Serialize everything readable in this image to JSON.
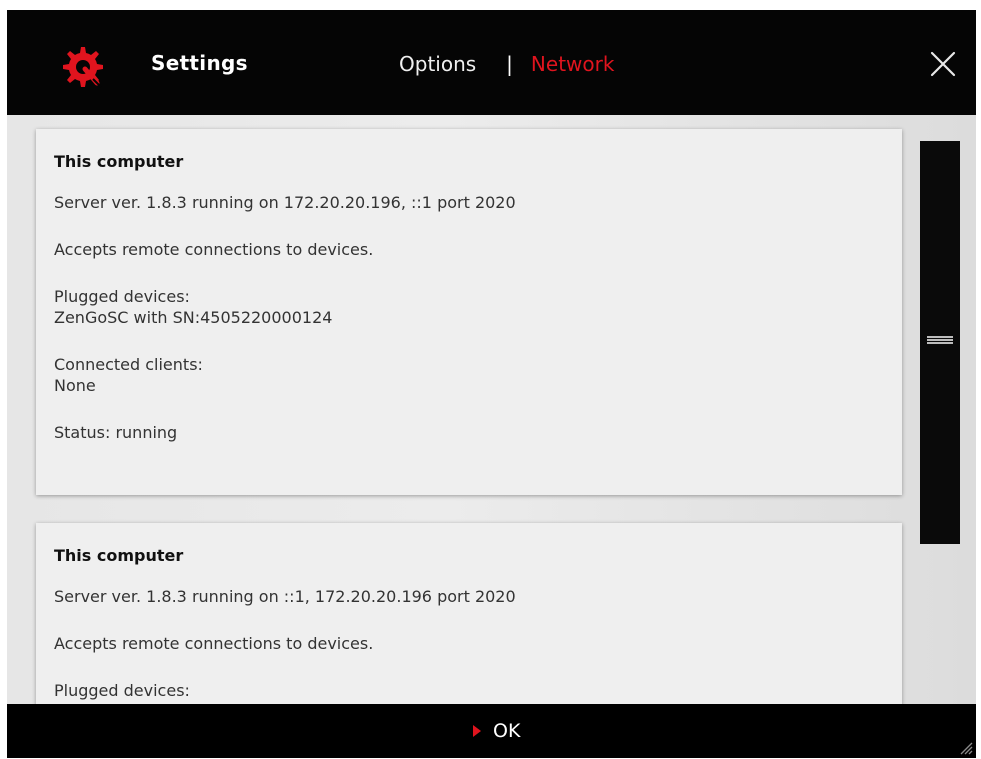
{
  "window": {
    "title": "Settings",
    "close_icon": "close-icon",
    "logo_icon": "gear-icon",
    "accent_color": "#e0141e"
  },
  "tabs": [
    {
      "label": "Options",
      "active": false
    },
    {
      "label": "Network",
      "active": true
    }
  ],
  "tab_separator": "|",
  "servers": [
    {
      "title": "This computer",
      "server_info": "Server ver. 1.8.3 running on 172.20.20.196, ::1 port 2020",
      "remote_note": "Accepts remote connections to devices.",
      "plugged_label": "Plugged devices:",
      "plugged_value": "ZenGoSC with SN:4505220000124",
      "clients_label": "Connected clients:",
      "clients_value": "None",
      "status": "Status: running"
    },
    {
      "title": "This computer",
      "server_info": "Server ver. 1.8.3 running on ::1, 172.20.20.196 port 2020",
      "remote_note": "Accepts remote connections to devices.",
      "plugged_label": "Plugged devices:"
    }
  ],
  "footer": {
    "ok_label": "OK",
    "ok_icon": "play-arrow-icon",
    "resize_icon": "resize-grip-icon"
  }
}
